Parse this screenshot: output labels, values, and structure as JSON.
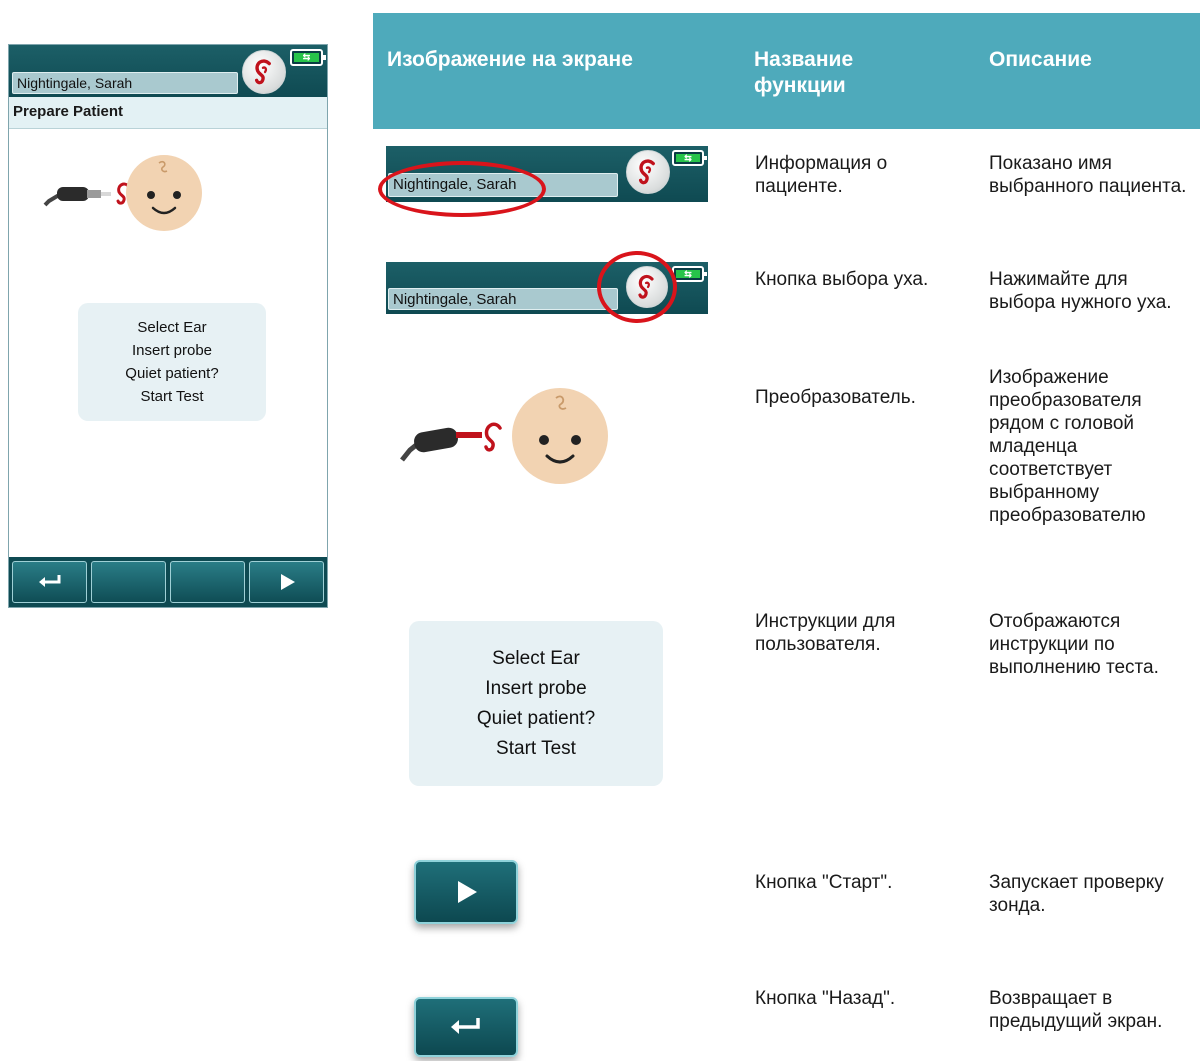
{
  "device": {
    "patient_name": "Nightingale, Sarah",
    "screen_title": "Prepare Patient",
    "instructions": [
      "Select Ear",
      "Insert probe",
      "Quiet patient?",
      "Start Test"
    ]
  },
  "table": {
    "headers": {
      "image": "Изображение на экране",
      "function": "Название функции",
      "description": "Описание"
    },
    "rows": [
      {
        "function": "Информация о пациенте.",
        "description": "Показано имя выбранного пациента."
      },
      {
        "function": "Кнопка выбора уха.",
        "description": "Нажимайте для выбора нужного уха."
      },
      {
        "function": "Преобразователь.",
        "description": "Изображение преобразователя рядом с головой младенца соответствует выбранному преобразователю"
      },
      {
        "function": "Инструкции для пользователя.",
        "description": "Отображаются инструкции по выполнению теста."
      },
      {
        "function": "Кнопка \"Старт\".",
        "description": "Запускает проверку зонда."
      },
      {
        "function": "Кнопка \"Назад\".",
        "description": "Возвращает в предыдущий экран."
      }
    ]
  },
  "colors": {
    "header_teal": "#4eaabb",
    "device_dark": "#0f4a52",
    "highlight_red": "#d9141b",
    "ear_red": "#c0121c",
    "battery_green": "#27c44a"
  }
}
